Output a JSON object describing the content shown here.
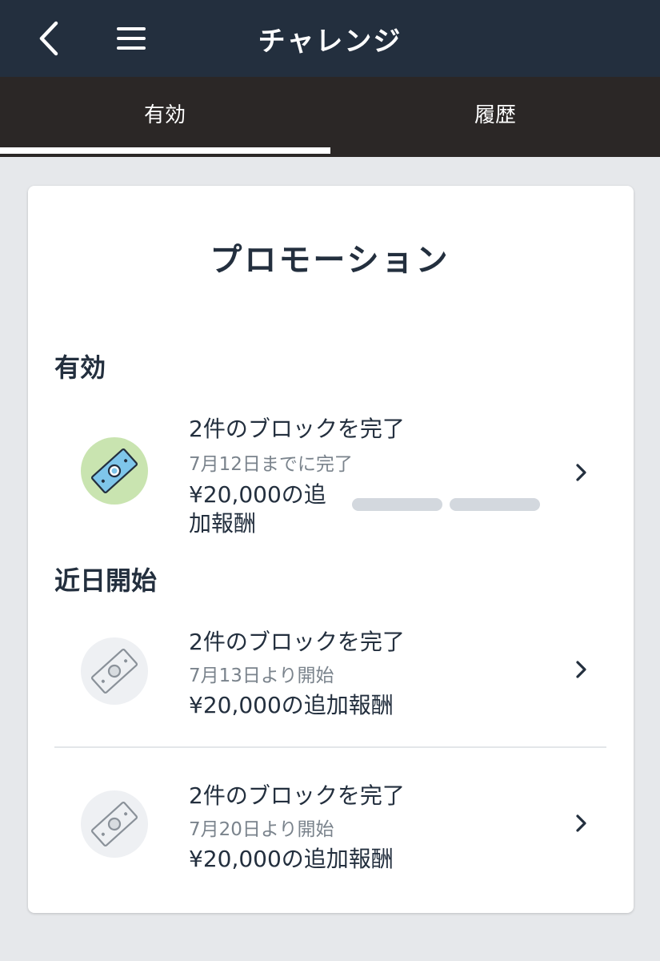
{
  "header": {
    "title": "チャレンジ",
    "back_icon": "chevron-left-icon",
    "menu_icon": "hamburger-menu-icon"
  },
  "tabs": [
    {
      "label": "有効",
      "selected": true
    },
    {
      "label": "履歴",
      "selected": false
    }
  ],
  "card": {
    "title": "プロモーション",
    "sections": {
      "active": {
        "label": "有効",
        "items": [
          {
            "title": "2件のブロックを完了",
            "date": "7月12日までに完了",
            "reward_line1": "¥20,000の追",
            "reward_line2": "加報酬",
            "progress_completed": 0,
            "progress_total": 2,
            "icon": "money-bill-icon"
          }
        ]
      },
      "upcoming": {
        "label": "近日開始",
        "items": [
          {
            "title": "2件のブロックを完了",
            "date": "7月13日より開始",
            "reward": "¥20,000の追加報酬",
            "icon": "money-bill-icon"
          },
          {
            "title": "2件のブロックを完了",
            "date": "7月20日より開始",
            "reward": "¥20,000の追加報酬",
            "icon": "money-bill-icon"
          }
        ]
      }
    }
  },
  "colors": {
    "header_bg": "#232f3e",
    "tab_bg": "#2b2726",
    "page_bg": "#e6e8eb",
    "active_icon_bg": "#c9e4b0",
    "bill_fill": "#7fc6ea",
    "progress_empty": "#d3d8de"
  }
}
